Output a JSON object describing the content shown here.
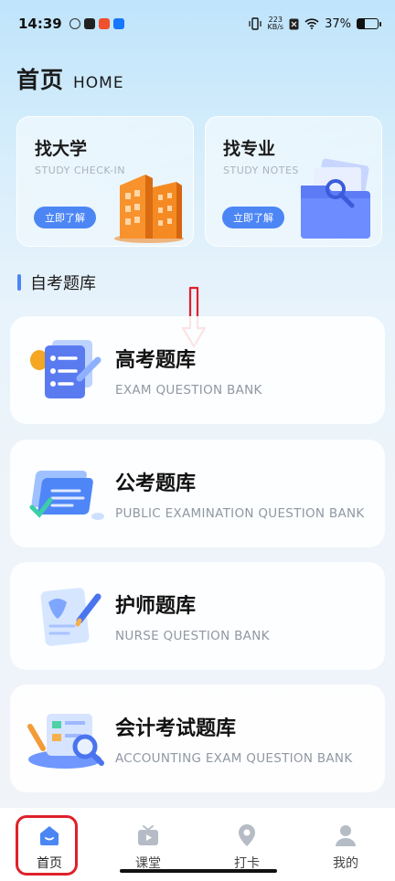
{
  "status_bar": {
    "time": "14:39",
    "net_speed_value": "223",
    "net_speed_unit": "KB/s",
    "battery": "37%",
    "battery_level": 0.37
  },
  "header": {
    "title": "首页",
    "subtitle": "HOME"
  },
  "top_cards": [
    {
      "title": "找大学",
      "subtitle": "STUDY CHECK-IN",
      "button": "立即了解",
      "icon": "building-icon"
    },
    {
      "title": "找专业",
      "subtitle": "STUDY NOTES",
      "button": "立即了解",
      "icon": "folder-icon"
    }
  ],
  "section": {
    "title": "自考题库"
  },
  "banks": [
    {
      "name": "高考题库",
      "en": "EXAM QUESTION BANK",
      "icon": "checklist-icon"
    },
    {
      "name": "公考题库",
      "en": "PUBLIC EXAMINATION QUESTION BANK",
      "icon": "document-card-icon"
    },
    {
      "name": "护师题库",
      "en": "NURSE QUESTION BANK",
      "icon": "nurse-note-icon"
    },
    {
      "name": "会计考试题库",
      "en": "ACCOUNTING EXAM QUESTION BANK",
      "icon": "magnifier-report-icon"
    }
  ],
  "tabs": [
    {
      "label": "首页",
      "icon": "home-icon",
      "active": true
    },
    {
      "label": "课堂",
      "icon": "tv-play-icon",
      "active": false
    },
    {
      "label": "打卡",
      "icon": "location-pin-icon",
      "active": false
    },
    {
      "label": "我的",
      "icon": "person-icon",
      "active": false
    }
  ],
  "colors": {
    "accent": "#4c86f5",
    "annotation": "#e0202a"
  }
}
